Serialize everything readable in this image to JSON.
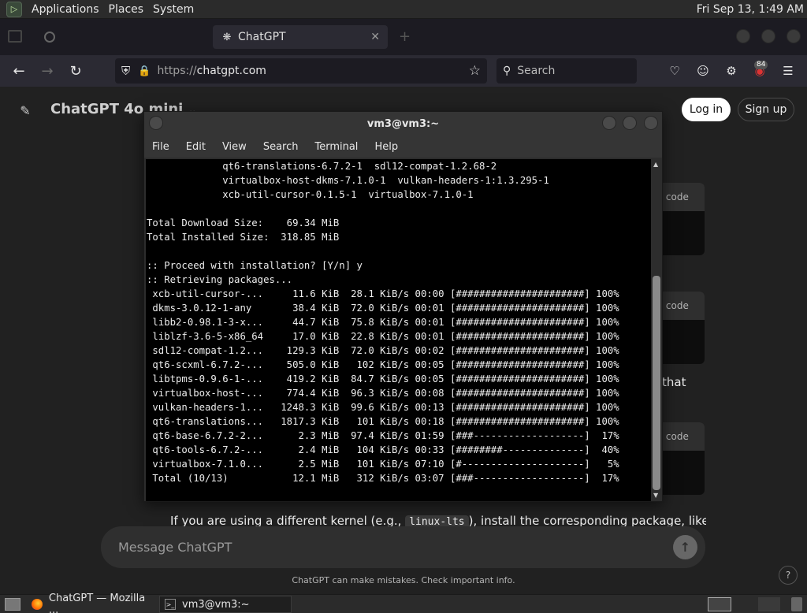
{
  "top_panel": {
    "menus": [
      "Applications",
      "Places",
      "System"
    ],
    "clock": "Fri Sep 13, 1:49 AM"
  },
  "browser": {
    "tabs": [
      {
        "title": "ChatGPT",
        "active": true
      }
    ],
    "url_scheme": "https://",
    "url_host": "chatgpt.com",
    "search_placeholder": "Search",
    "extension_badge": "84"
  },
  "chatgpt": {
    "model_title": "ChatGPT 4o mini",
    "login_label": "Log in",
    "signup_label": "Sign up",
    "copy_code_fragment": "y code",
    "side_text_fragment": "that",
    "body_text_before": "If you are using a different kernel (e.g., ",
    "body_text_code": "linux-lts",
    "body_text_after": "), install the corresponding package, like:",
    "composer_placeholder": "Message ChatGPT",
    "disclaimer": "ChatGPT can make mistakes. Check important info.",
    "help_label": "?"
  },
  "terminal": {
    "title": "vm3@vm3:~",
    "menu": [
      "File",
      "Edit",
      "View",
      "Search",
      "Terminal",
      "Help"
    ],
    "lines": [
      "             qt6-translations-6.7.2-1  sdl12-compat-1.2.68-2",
      "             virtualbox-host-dkms-7.1.0-1  vulkan-headers-1:1.3.295-1",
      "             xcb-util-cursor-0.1.5-1  virtualbox-7.1.0-1",
      "",
      "Total Download Size:    69.34 MiB",
      "Total Installed Size:  318.85 MiB",
      "",
      ":: Proceed with installation? [Y/n] y",
      ":: Retrieving packages...",
      " xcb-util-cursor-...     11.6 KiB  28.1 KiB/s 00:00 [######################] 100%",
      " dkms-3.0.12-1-any       38.4 KiB  72.0 KiB/s 00:01 [######################] 100%",
      " libb2-0.98.1-3-x...     44.7 KiB  75.8 KiB/s 00:01 [######################] 100%",
      " liblzf-3.6-5-x86_64     17.0 KiB  22.8 KiB/s 00:01 [######################] 100%",
      " sdl12-compat-1.2...    129.3 KiB  72.0 KiB/s 00:02 [######################] 100%",
      " qt6-scxml-6.7.2-...    505.0 KiB   102 KiB/s 00:05 [######################] 100%",
      " libtpms-0.9.6-1-...    419.2 KiB  84.7 KiB/s 00:05 [######################] 100%",
      " virtualbox-host-...    774.4 KiB  96.3 KiB/s 00:08 [######################] 100%",
      " vulkan-headers-1...   1248.3 KiB  99.6 KiB/s 00:13 [######################] 100%",
      " qt6-translations...   1817.3 KiB   101 KiB/s 00:18 [######################] 100%",
      " qt6-base-6.7.2-2...      2.3 MiB  97.4 KiB/s 01:59 [###-------------------]  17%",
      " qt6-tools-6.7.2-...      2.4 MiB   104 KiB/s 00:33 [########--------------]  40%",
      " virtualbox-7.1.0...      2.5 MiB   101 KiB/s 07:10 [#---------------------]   5%",
      " Total (10/13)           12.1 MiB   312 KiB/s 03:07 [###-------------------]  17%"
    ]
  },
  "taskbar": {
    "items": [
      {
        "label": "ChatGPT — Mozilla ...",
        "active": false
      },
      {
        "label": "vm3@vm3:~",
        "active": true
      }
    ]
  }
}
